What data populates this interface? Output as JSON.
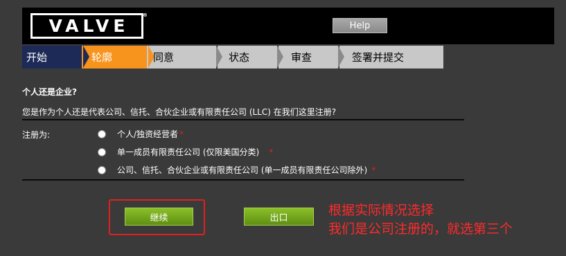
{
  "header": {
    "logo_text": "VALVE",
    "logo_reg": "®",
    "help_label": "Help"
  },
  "steps": [
    {
      "label": "开始",
      "bg": "#1d2a57",
      "color": "#ffffff"
    },
    {
      "label": "轮廓",
      "bg": "#f7941d",
      "color": "#ffffff"
    },
    {
      "label": "同意",
      "bg": "#c8c8c8",
      "color": "#000000"
    },
    {
      "label": "状态",
      "bg": "#c8c8c8",
      "color": "#000000"
    },
    {
      "label": "审查",
      "bg": "#c8c8c8",
      "color": "#000000"
    },
    {
      "label": "签署并提交",
      "bg": "#c8c8c8",
      "color": "#000000"
    }
  ],
  "form": {
    "question_title": "个人还是企业?",
    "question_text": "您是作为个人还是代表公司、信托、合伙企业或有限责任公司 (LLC) 在我们这里注册?",
    "register_as_label": "注册为:",
    "options": [
      {
        "label": "个人/独资经营者",
        "required": "*"
      },
      {
        "label": "单一成员有限责任公司 (仅限美国分类)",
        "required": "*"
      },
      {
        "label": "公司、信托、合伙企业或有限责任公司 (单一成员有限责任公司除外)",
        "required": "*"
      }
    ]
  },
  "buttons": {
    "continue_label": "继续",
    "exit_label": "出口"
  },
  "annotation": {
    "line1": "根据实际情况选择",
    "line2": "我们是公司注册的，就选第三个"
  },
  "colors": {
    "accent_orange": "#f7941d",
    "step_done": "#1d2a57",
    "button_green": "#7aaa1f",
    "annotation_red": "#ff2a2a"
  }
}
